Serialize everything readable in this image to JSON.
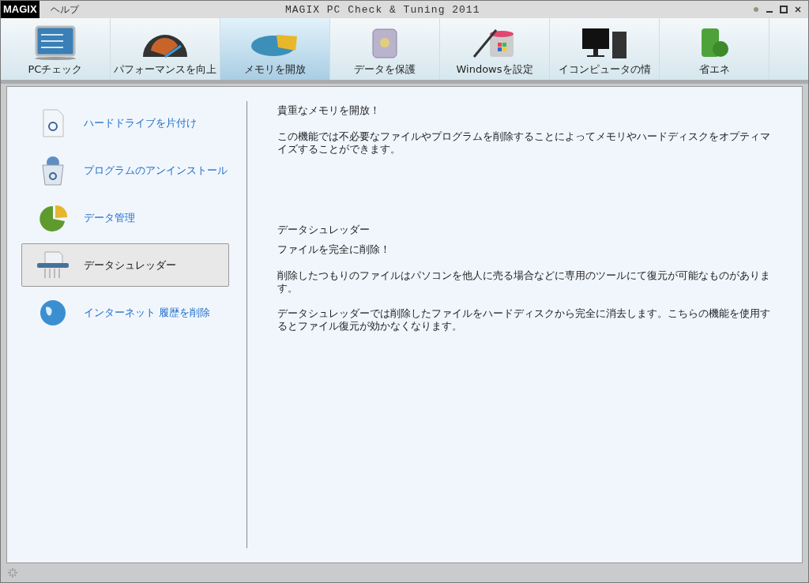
{
  "window": {
    "logo": "MAGIX",
    "menu": [
      "ヘルプ"
    ],
    "title": "MAGIX PC Check & Tuning 2011"
  },
  "tabs": [
    {
      "label": "PCチェック",
      "selected": false
    },
    {
      "label": "パフォーマンスを向上",
      "selected": false
    },
    {
      "label": "メモリを開放",
      "selected": true
    },
    {
      "label": "データを保護",
      "selected": false
    },
    {
      "label": "Windowsを設定",
      "selected": false
    },
    {
      "label": "イコンピュータの情",
      "selected": false
    },
    {
      "label": "省エネ",
      "selected": false
    }
  ],
  "sidebar": {
    "items": [
      {
        "label": "ハードドライブを片付け",
        "selected": false
      },
      {
        "label": "プログラムのアンインストール",
        "selected": false
      },
      {
        "label": "データ管理",
        "selected": false
      },
      {
        "label": "データシュレッダー",
        "selected": true
      },
      {
        "label": "インターネット 履歴を削除",
        "selected": false
      }
    ]
  },
  "content": {
    "heading": "貴重なメモリを開放！",
    "intro": "この機能では不必要なファイルやプログラムを削除することによってメモリやハードディスクをオプティマイズすることができます。",
    "section_title": "データシュレッダー",
    "subheading": "ファイルを完全に削除！",
    "paragraphs": [
      "削除したつもりのファイルはパソコンを他人に売る場合などに専用のツールにて復元が可能なものがあります。",
      "データシュレッダーでは削除したファイルをハードディスクから完全に消去します。こちらの機能を使用するとファイル復元が効かなくなります。"
    ]
  }
}
